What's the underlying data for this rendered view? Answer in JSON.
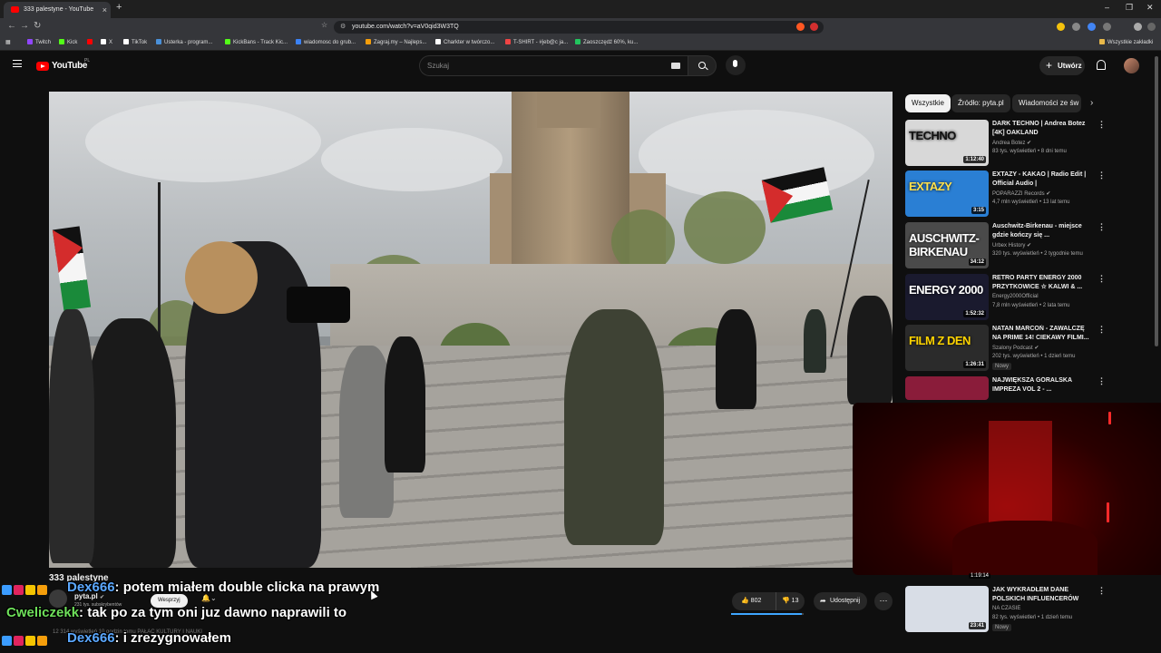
{
  "browser": {
    "tab_title": "333 palestyne - YouTube",
    "tab_close": "×",
    "new_tab": "+",
    "url": "youtube.com/watch?v=aV0qid3W3TQ",
    "back": "←",
    "forward": "→",
    "reload": "↻",
    "win_min": "–",
    "win_max": "❐",
    "win_close": "✕",
    "bookmarks": [
      {
        "label": "Twitch",
        "color": "#9146ff"
      },
      {
        "label": "Kick",
        "color": "#53fc18"
      },
      {
        "label": "",
        "color": "#ff0000"
      },
      {
        "label": "X",
        "color": "#ffffff"
      },
      {
        "label": "TikTok",
        "color": "#ffffff"
      },
      {
        "label": "Usterka - program...",
        "color": "#4a90d9"
      },
      {
        "label": "KickBans - Track Kic...",
        "color": "#53fc18"
      },
      {
        "label": "wiadomosc do grub...",
        "color": "#3b82f6"
      },
      {
        "label": "Zagraj.my – Najleps...",
        "color": "#f59e0b"
      },
      {
        "label": "Charkter w twórczo...",
        "color": "#ffffff"
      },
      {
        "label": "T-SHIRT - #jeb@c ja...",
        "color": "#ef4444"
      },
      {
        "label": "Zaoszczędź 60%, ku...",
        "color": "#22c55e"
      }
    ],
    "all_bookmarks": "Wszystkie zakładki"
  },
  "header": {
    "logo": "YouTube",
    "region": "PL",
    "search_placeholder": "Szukaj",
    "create": "Utwórz"
  },
  "chips": [
    "Wszystkie",
    "Źródło: pyta.pl",
    "Wiadomości ze św"
  ],
  "recommendations": [
    {
      "title": "DARK TECHNO | Andrea Botez [4K] OAKLAND",
      "channel": "Andrea Botez ✔",
      "meta": "83 tys. wyświetleń • 8 dni temu",
      "duration": "1:12:40",
      "thumb_text": "TECHNO",
      "thumb_bg": "#d8d8d8",
      "thumb_fg": "#111111",
      "badge": ""
    },
    {
      "title": "EXTAZY - KAKAO | Radio Edit | Official Audio |",
      "channel": "POPARAZZI Records ✔",
      "meta": "4,7 mln wyświetleń • 13 lat temu",
      "duration": "3:15",
      "thumb_text": "EXTAZY",
      "thumb_bg": "#2a7fd4",
      "thumb_fg": "#ffe14d",
      "badge": ""
    },
    {
      "title": "Auschwitz-Birkenau - miejsce gdzie kończy się ...",
      "channel": "Urbex History ✔",
      "meta": "320 tys. wyświetleń • 2 tygodnie temu",
      "duration": "34:12",
      "thumb_text": "AUSCHWITZ-BIRKENAU",
      "thumb_bg": "#4a4a4a",
      "thumb_fg": "#ffffff",
      "badge": ""
    },
    {
      "title": "RETRO PARTY ENERGY 2000 PRZYTKOWICE ☆ KALWI & ...",
      "channel": "Energy2000Official",
      "meta": "7,8 mln wyświetleń • 2 lata temu",
      "duration": "1:52:32",
      "thumb_text": "ENERGY 2000",
      "thumb_bg": "#1a1a2e",
      "thumb_fg": "#ffffff",
      "badge": ""
    },
    {
      "title": "NATAN MARCOŃ - ZAWALCZĘ NA PRIME 14! CIEKAWY FILMI...",
      "channel": "Szalony Podcast ✔",
      "meta": "202 tys. wyświetleń • 1 dzień temu",
      "duration": "1:26:31",
      "thumb_text": "FILM Z DEN",
      "thumb_bg": "#2b2b2b",
      "thumb_fg": "#ffd400",
      "badge": "Nowy"
    },
    {
      "title": "NAJWIĘKSZA GÓRALSKA IMPREZA VOL 2 - ...",
      "channel": "",
      "meta": "",
      "duration": "",
      "thumb_text": "",
      "thumb_bg": "#8a1c3a",
      "thumb_fg": "#ffffff",
      "badge": ""
    },
    {
      "title": "JAK WYKRADŁEM DANE POLSKICH INFLUENCERÓW",
      "channel": "NA CZASIE",
      "meta": "82 tys. wyświetleń • 1 dzień temu",
      "duration": "23:41",
      "thumb_text": "",
      "thumb_bg": "#d8dde6",
      "thumb_fg": "#111111",
      "badge": "Nowy"
    }
  ],
  "video": {
    "title": "333 palestyne",
    "channel": "pyta.pl",
    "verified": "✔",
    "subscribers": "231 tys. subskrybentów",
    "support": "Wesprzyj",
    "likes": "802",
    "like_ratio": 0.98,
    "dislikes": "13",
    "share": "Udostępnij",
    "description_peek": "12 314 wyświetleń  10 godzin temu  PAŁAC KULTURY I NAUKI"
  },
  "partial_timestamp": "1:19:14",
  "chat": [
    {
      "user": "Dex666",
      "color": "#5ba8ff",
      "message": ": potem miałem double clicka na prawym",
      "badges": [
        "#3b9cff",
        "#e0245e",
        "#f5c400",
        "#f59e0b"
      ]
    },
    {
      "user": "Cweliczekk",
      "color": "#6ee05a",
      "message": ": tak po za tym oni juz dawno naprawili to",
      "badges": []
    },
    {
      "user": "Dex666",
      "color": "#5ba8ff",
      "message": ": i zrezygnowałem",
      "badges": [
        "#3b9cff",
        "#e0245e",
        "#f5c400",
        "#f59e0b"
      ]
    }
  ]
}
